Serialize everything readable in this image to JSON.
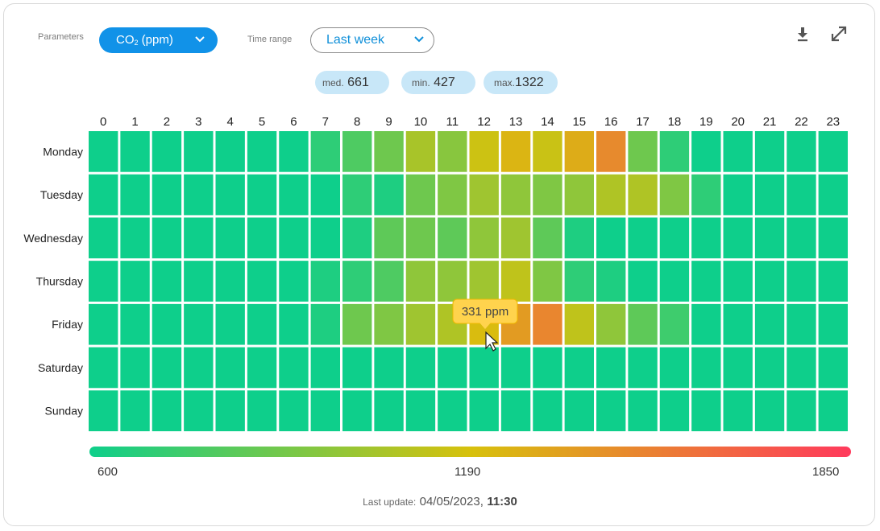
{
  "controls": {
    "parameters_label": "Parameters",
    "parameter_main": "CO",
    "parameter_sub": "2",
    "parameter_unit": " (ppm)",
    "time_range_label": "Time range",
    "time_range_value": "Last week"
  },
  "stats": {
    "med_label": "med.",
    "med_value": "661",
    "min_label": "min.",
    "min_value": "427",
    "max_label": "max.",
    "max_value": "1322"
  },
  "tooltip": {
    "text": "331 ppm"
  },
  "legend": {
    "min": "600",
    "mid": "1190",
    "max": "1850"
  },
  "footer": {
    "label": "Last update:",
    "date": "04/05/2023,",
    "time": "11:30"
  },
  "colors": {
    "accent": "#1192e8",
    "pill": "#c8e7f8",
    "tooltip": "#ffd34d"
  },
  "chart_data": {
    "type": "heatmap",
    "x": [
      "0",
      "1",
      "2",
      "3",
      "4",
      "5",
      "6",
      "7",
      "8",
      "9",
      "10",
      "11",
      "12",
      "13",
      "14",
      "15",
      "16",
      "17",
      "18",
      "19",
      "20",
      "21",
      "22",
      "23"
    ],
    "y": [
      "Monday",
      "Tuesday",
      "Wednesday",
      "Thursday",
      "Friday",
      "Saturday",
      "Sunday"
    ],
    "color_scale": {
      "min": 600,
      "max": 1850,
      "stops": [
        "#0ecf8b",
        "#d7c10c",
        "#ff3a5c"
      ]
    },
    "values": [
      [
        600,
        600,
        600,
        600,
        600,
        600,
        600,
        700,
        800,
        900,
        1080,
        980,
        1190,
        1280,
        1180,
        1320,
        1480,
        900,
        700,
        600,
        600,
        600,
        600,
        600
      ],
      [
        600,
        600,
        600,
        600,
        600,
        600,
        600,
        600,
        700,
        650,
        900,
        950,
        1050,
        1000,
        950,
        1000,
        1100,
        1100,
        950,
        700,
        600,
        600,
        600,
        600
      ],
      [
        600,
        600,
        600,
        600,
        600,
        600,
        600,
        600,
        650,
        850,
        900,
        850,
        1000,
        1050,
        850,
        650,
        600,
        600,
        600,
        600,
        600,
        600,
        600,
        600
      ],
      [
        600,
        600,
        600,
        600,
        600,
        600,
        600,
        650,
        700,
        800,
        1000,
        1000,
        1050,
        1150,
        950,
        700,
        650,
        600,
        600,
        600,
        600,
        600,
        600,
        600
      ],
      [
        600,
        600,
        600,
        600,
        600,
        600,
        600,
        650,
        900,
        950,
        1050,
        1100,
        1250,
        1400,
        1500,
        1150,
        1000,
        850,
        750,
        600,
        600,
        600,
        600,
        600
      ],
      [
        600,
        600,
        600,
        600,
        600,
        600,
        600,
        600,
        600,
        600,
        600,
        600,
        600,
        600,
        600,
        600,
        600,
        600,
        600,
        600,
        600,
        600,
        600,
        600
      ],
      [
        600,
        600,
        600,
        600,
        600,
        600,
        600,
        600,
        600,
        600,
        600,
        600,
        600,
        600,
        600,
        600,
        600,
        600,
        600,
        600,
        600,
        600,
        600,
        600
      ]
    ],
    "legend_placement": "bottom"
  }
}
